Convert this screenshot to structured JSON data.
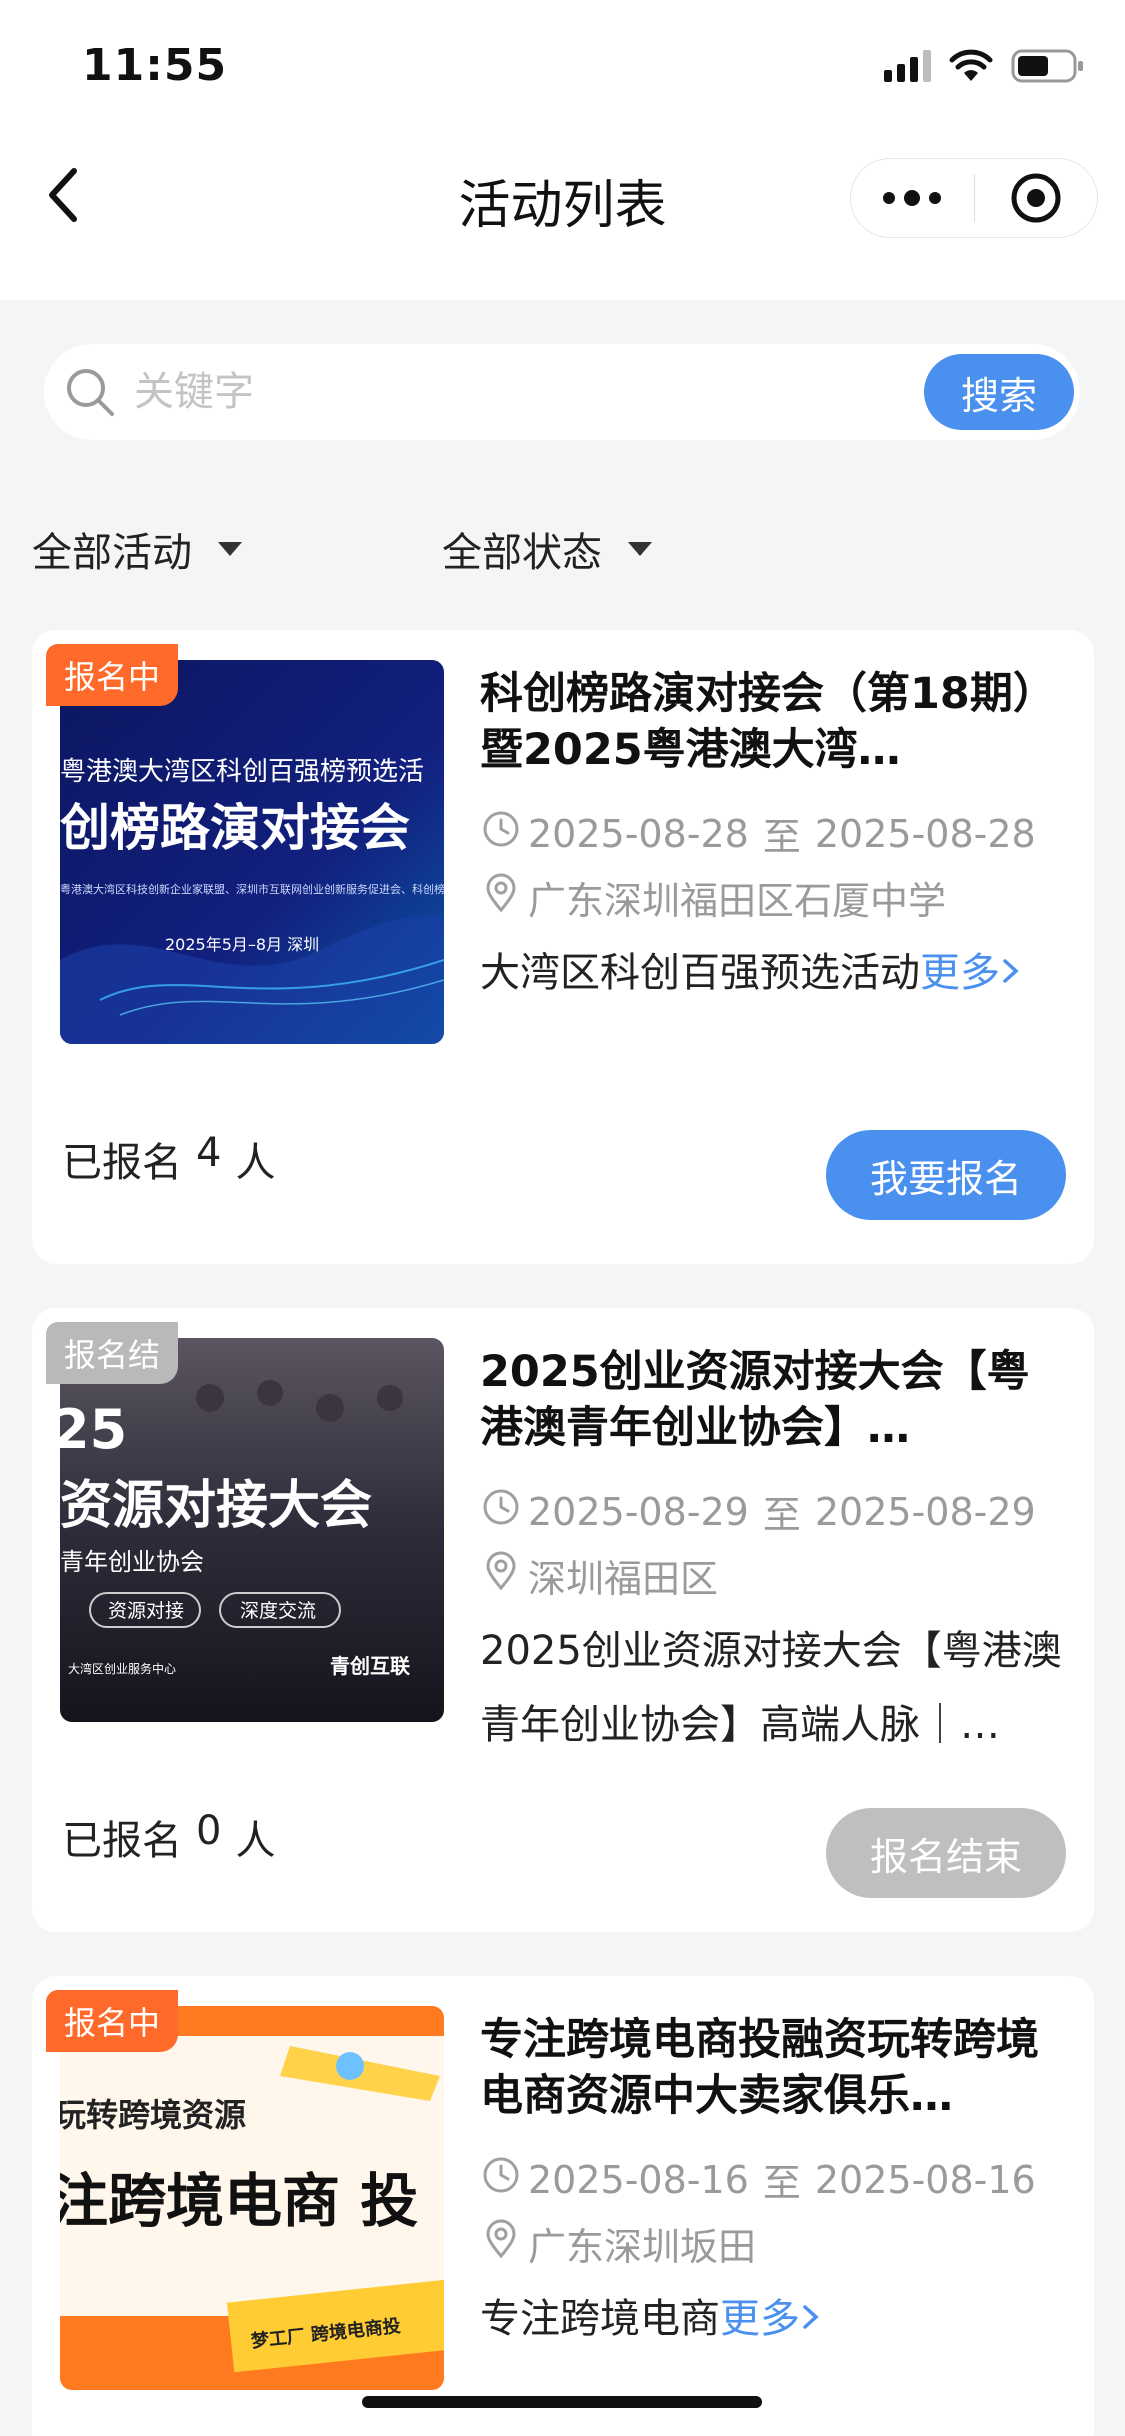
{
  "status_bar": {
    "time": "11:55"
  },
  "nav": {
    "title": "活动列表"
  },
  "search": {
    "placeholder": "关键字",
    "button_label": "搜索"
  },
  "filters": {
    "type_label": "全部活动",
    "status_label": "全部状态"
  },
  "colors": {
    "accent": "#4a90ee",
    "tag_open": "#ff6a2a",
    "tag_closed": "#b9b9b9",
    "disabled": "#bfbfbf",
    "background": "#f4f5f7"
  },
  "events": [
    {
      "status_tag": "报名中",
      "title": "科创榜路演对接会（第18期）暨2025粤港澳大湾…",
      "date_start": "2025-08-28",
      "date_sep": "至",
      "date_end": "2025-08-28",
      "location": "广东深圳福田区石厦中学",
      "desc": "大湾区科创百强预选活动",
      "more_label": "更多",
      "enrolled_prefix": "已报名",
      "enrolled_count": "4",
      "enrolled_suffix": "人",
      "action_label": "我要报名",
      "poster": {
        "line1": "粤港澳大湾区科创百强榜预选活",
        "line2": "创榜路演对接会",
        "line3": "粤港澳大湾区科技创新企业家联盟、深圳市互联网创业创新服务促进会、科创榜",
        "line4": "2025年5月–8月    深圳"
      }
    },
    {
      "status_tag": "报名结",
      "title": "2025创业资源对接大会【粤港澳青年创业协会】…",
      "date_start": "2025-08-29",
      "date_sep": "至",
      "date_end": "2025-08-29",
      "location": "深圳福田区",
      "desc": "2025创业资源对接大会【粤港澳青年创业协会】高端人脉｜…",
      "enrolled_prefix": "已报名",
      "enrolled_count": "0",
      "enrolled_suffix": "人",
      "action_label": "报名结束",
      "poster": {
        "year": "25",
        "line1": "资源对接大会",
        "line2": "青年创业协会",
        "chip1": "资源对接",
        "chip2": "深度交流",
        "logo1": "大湾区创业服务中心",
        "logo2": "青创互联"
      }
    },
    {
      "status_tag": "报名中",
      "title": "专注跨境电商投融资玩转跨境电商资源中大卖家俱乐…",
      "date_start": "2025-08-16",
      "date_sep": "至",
      "date_end": "2025-08-16",
      "location": "广东深圳坂田",
      "desc": "专注跨境电商",
      "more_label": "更多",
      "poster": {
        "line1": "玩转跨境资源",
        "line2": "注跨境电商 投",
        "line3": "梦工厂 跨境电商投"
      }
    }
  ]
}
